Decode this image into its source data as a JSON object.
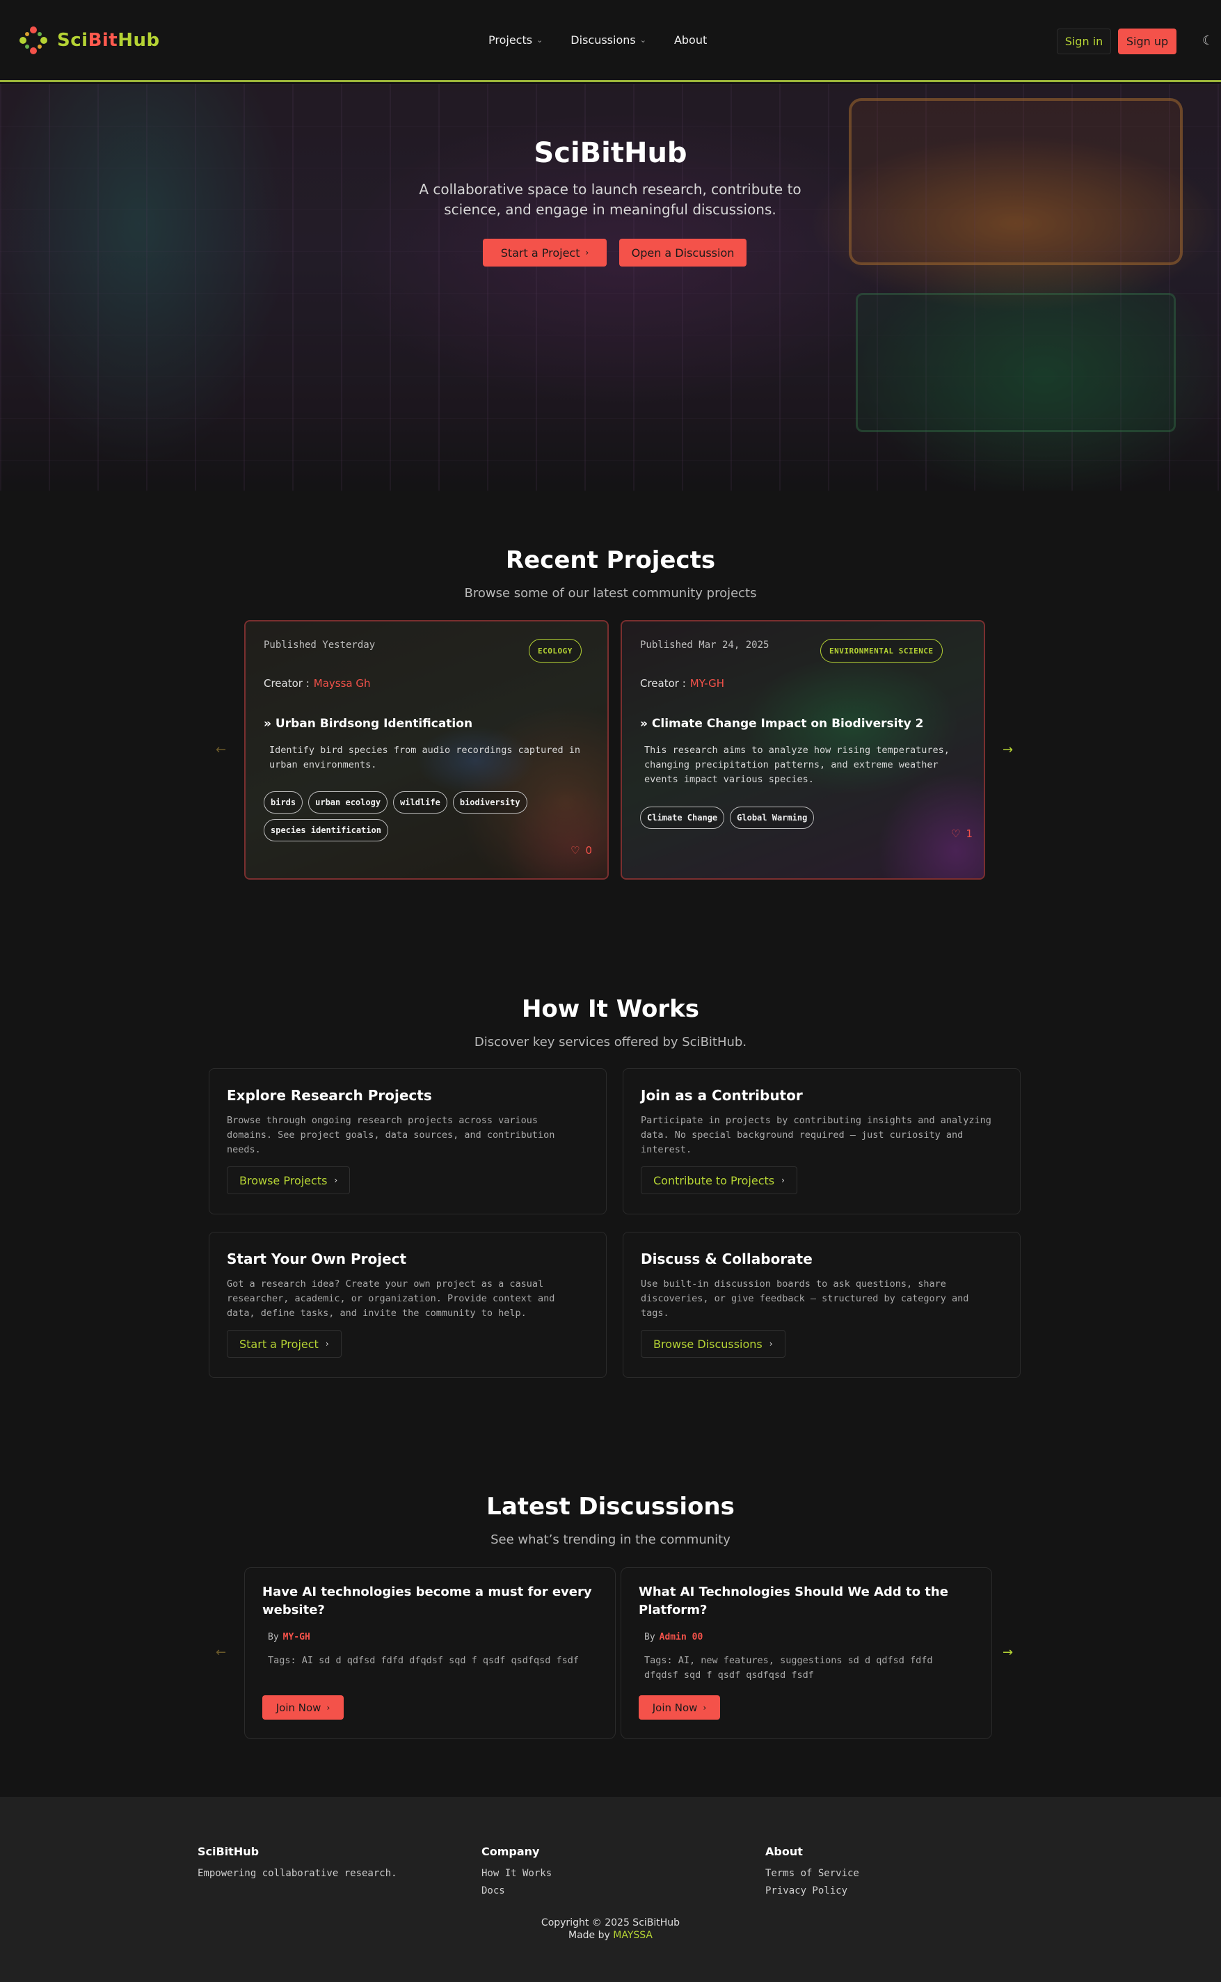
{
  "nav": {
    "logo": {
      "part1": "Sci",
      "part2": "Bit",
      "part3": "Hub"
    },
    "links": [
      "Projects",
      "Discussions",
      "About"
    ],
    "signin": "Sign in",
    "signup": "Sign up",
    "theme_icon": "moon-icon"
  },
  "hero": {
    "title": "SciBitHub",
    "subtitle": "A collaborative space to launch research, contribute to science, and engage in meaningful discussions.",
    "primary_button": "Start a Project",
    "secondary_button": "Open a Discussion"
  },
  "projects": {
    "title": "Recent Projects",
    "subtitle": "Browse some of our latest community projects",
    "creator_label": "Creator :",
    "items": [
      {
        "published": "Published Yesterday",
        "category": "ECOLOGY",
        "creator": "Mayssa Gh",
        "title": "» Urban Birdsong Identification",
        "description": "Identify bird species from audio recordings captured in urban environments.",
        "tags": [
          "birds",
          "urban ecology",
          "wildlife",
          "biodiversity",
          "species identification"
        ],
        "likes": "0"
      },
      {
        "published": "Published Mar 24, 2025",
        "category": "ENVIRONMENTAL SCIENCE",
        "creator": "MY-GH",
        "title": "» Climate Change Impact on Biodiversity 2",
        "description": "This research aims to analyze how rising temperatures, changing precipitation patterns, and extreme weather events impact various species.",
        "tags": [
          "Climate Change",
          "Global Warming"
        ],
        "likes": "1"
      }
    ]
  },
  "how": {
    "title": "How It Works",
    "subtitle": "Discover key services offered by SciBitHub.",
    "cards": [
      {
        "title": "Explore Research Projects",
        "desc": "Browse through ongoing research projects across various domains. See project goals, data sources, and contribution needs.",
        "link": "Browse Projects"
      },
      {
        "title": "Join as a Contributor",
        "desc": "Participate in projects by contributing insights and analyzing data. No special background required — just curiosity and interest.",
        "link": "Contribute to Projects"
      },
      {
        "title": "Start Your Own Project",
        "desc": "Got a research idea? Create your own project as a casual researcher, academic, or organization. Provide context and data, define tasks, and invite the community to help.",
        "link": "Start a Project"
      },
      {
        "title": "Discuss & Collaborate",
        "desc": "Use built-in discussion boards to ask questions, share discoveries, or give feedback — structured by category and tags.",
        "link": "Browse Discussions"
      }
    ]
  },
  "discussions": {
    "title": "Latest Discussions",
    "subtitle": "See what’s trending in the community",
    "by_label": "By",
    "join_label": "Join Now",
    "items": [
      {
        "title": "Have AI technologies become a must for every website?",
        "author": "MY-GH",
        "tags": "Tags: AI sd d qdfsd fdfd dfqdsf sqd f qsdf qsdfqsd fsdf"
      },
      {
        "title": "What AI Technologies Should We Add to the Platform?",
        "author": "Admin 00",
        "tags": "Tags: AI, new features, suggestions sd d qdfsd fdfd dfqdsf sqd f qsdf qsdfqsd fsdf"
      }
    ]
  },
  "footer": {
    "brand": {
      "title": "SciBitHub",
      "tagline": "Empowering collaborative research."
    },
    "company": {
      "title": "Company",
      "items": [
        "How It Works",
        "Docs"
      ]
    },
    "about": {
      "title": "About",
      "items": [
        "Terms of Service",
        "Privacy Policy"
      ]
    },
    "copyright": "Copyright © 2025 SciBitHub",
    "made_by_prefix": "Made by",
    "made_by_name": "MAYSSA"
  },
  "colors": {
    "accent_green": "#b5d334",
    "accent_red": "#f4524a",
    "background": "#141414"
  }
}
